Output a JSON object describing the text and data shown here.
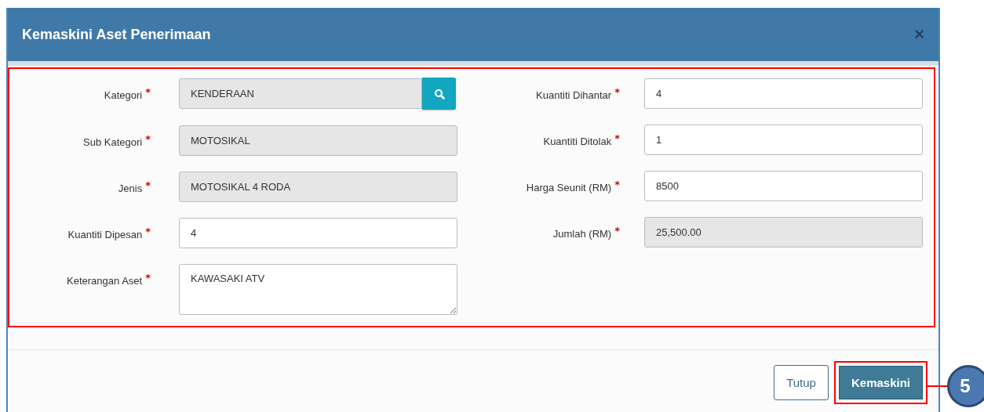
{
  "dialog": {
    "title": "Kemaskini Aset Penerimaan",
    "close": "×"
  },
  "form": {
    "highlighted": true,
    "required_mark": "*",
    "columns": [
      [
        {
          "label": "Kategori",
          "value": "KENDERAAN",
          "required": true,
          "readonly": true,
          "kind": "search"
        },
        {
          "label": "Sub Kategori",
          "value": "MOTOSIKAL",
          "required": true,
          "readonly": true,
          "kind": "text"
        },
        {
          "label": "Jenis",
          "value": "MOTOSIKAL 4 RODA",
          "required": true,
          "readonly": true,
          "kind": "text"
        },
        {
          "label": "Kuantiti Dipesan",
          "value": "4",
          "required": true,
          "readonly": false,
          "kind": "text"
        },
        {
          "label": "Keterangan Aset",
          "value": "KAWASAKI ATV",
          "required": true,
          "readonly": false,
          "kind": "textarea"
        }
      ],
      [
        {
          "label": "Kuantiti Dihantar",
          "value": "4",
          "required": true,
          "readonly": false,
          "kind": "text"
        },
        {
          "label": "Kuantiti Ditolak",
          "value": "1",
          "required": true,
          "readonly": false,
          "kind": "text"
        },
        {
          "label": "Harga Seunit (RM)",
          "value": "8500",
          "required": true,
          "readonly": false,
          "kind": "text"
        },
        {
          "label": "Jumlah (RM)",
          "value": "25,500.00",
          "required": true,
          "readonly": true,
          "kind": "text"
        }
      ]
    ]
  },
  "buttons": [
    {
      "label": "Tutup",
      "kind": "secondary",
      "highlighted": false
    },
    {
      "label": "Kemaskini",
      "kind": "primary",
      "highlighted": true
    }
  ],
  "callout": {
    "label": "5"
  }
}
